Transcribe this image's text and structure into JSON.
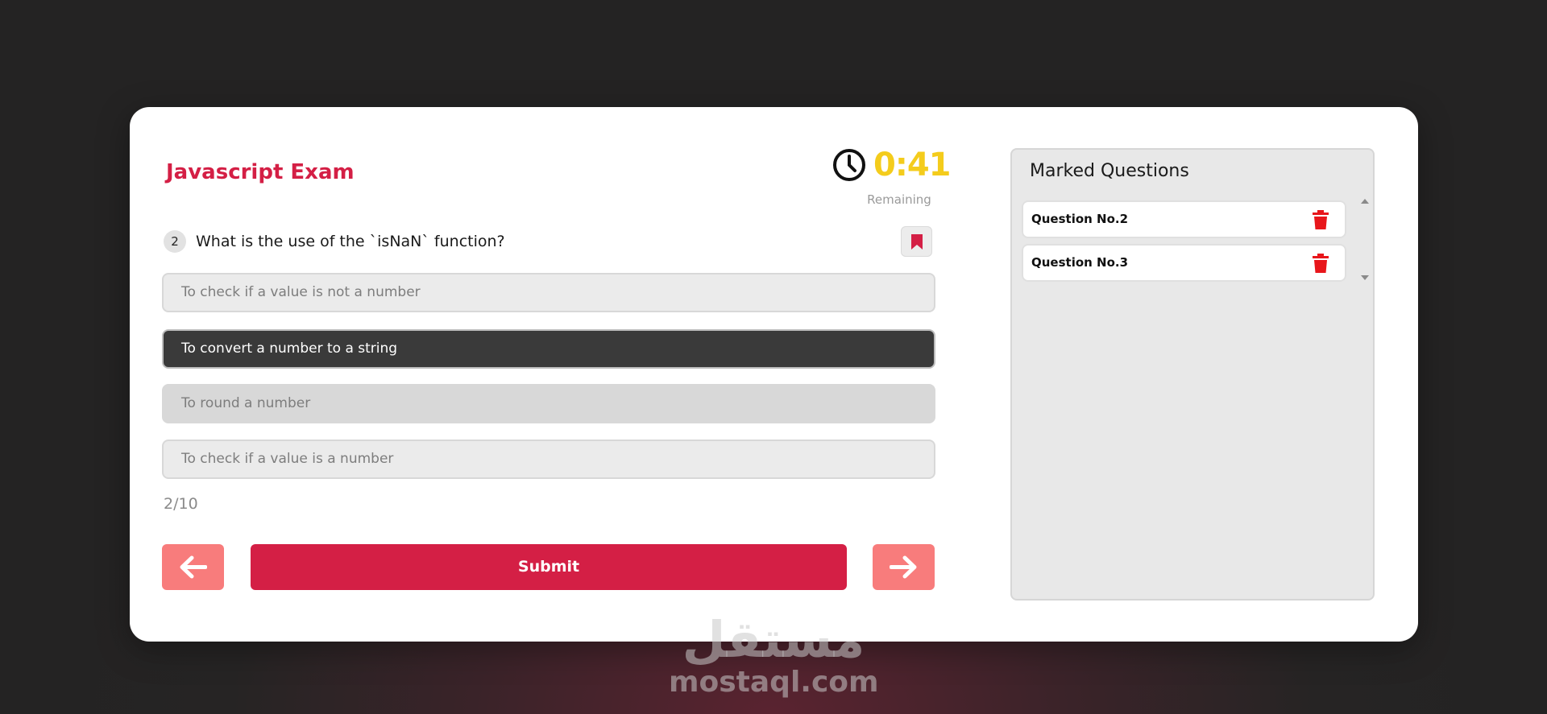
{
  "exam": {
    "title": "Javascript Exam"
  },
  "timer": {
    "time": "0:41",
    "label": "Remaining",
    "icon": "clock-icon",
    "color": "#f4cc1c"
  },
  "question": {
    "number": "2",
    "text": "What is the use of the `isNaN` function?",
    "bookmark_icon": "bookmark-icon",
    "options": [
      {
        "text": "To check if a value is not a number",
        "state": "default"
      },
      {
        "text": "To convert a number to a string",
        "state": "selected"
      },
      {
        "text": "To round a number",
        "state": "hover"
      },
      {
        "text": "To check if a value is a number",
        "state": "default"
      }
    ]
  },
  "progress": {
    "text": "2/10"
  },
  "nav": {
    "prev_icon": "arrow-left-icon",
    "next_icon": "arrow-right-icon",
    "submit_label": "Submit"
  },
  "marked": {
    "title": "Marked Questions",
    "items": [
      {
        "label": "Question No.2",
        "icon": "trash-icon"
      },
      {
        "label": "Question No.3",
        "icon": "trash-icon"
      }
    ]
  },
  "watermark": {
    "arabic": "مستقل",
    "latin": "mostaql.com"
  },
  "colors": {
    "accent": "#d41f45",
    "nav_button": "#f87c7c",
    "selected_option": "#3a3a3a"
  }
}
